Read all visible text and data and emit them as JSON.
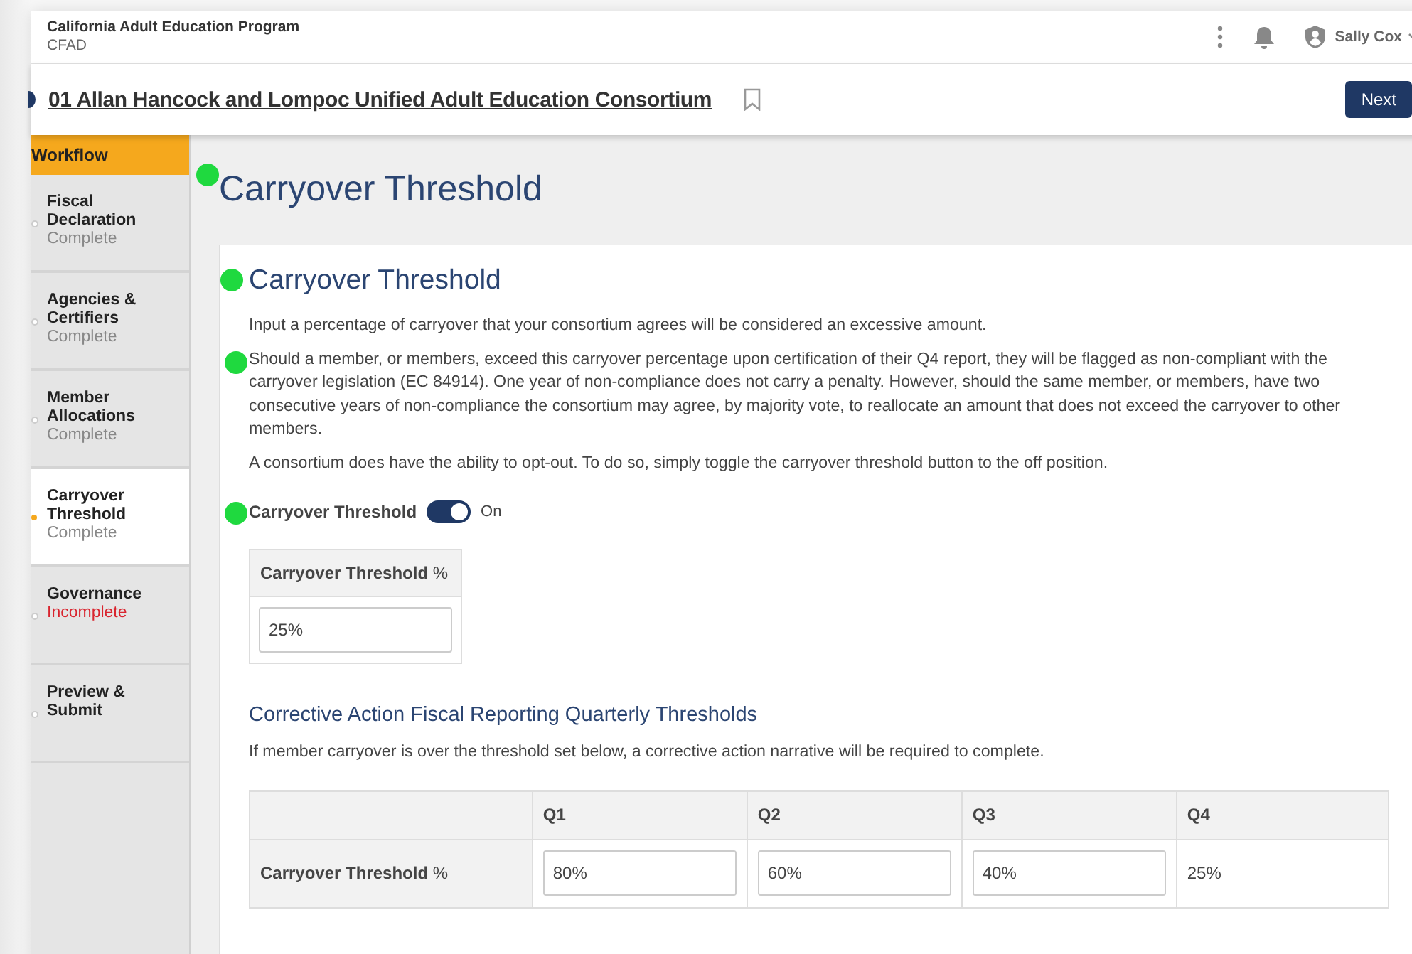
{
  "header": {
    "title": "California Adult Education Program",
    "subtitle": "CFAD",
    "user": "Sally Cox"
  },
  "consortium": {
    "name": "01 Allan Hancock and Lompoc Unified Adult Education Consortium"
  },
  "next_button": "Next",
  "sidebar": {
    "title": "Workflow",
    "items": [
      {
        "label": "Fiscal Declaration",
        "status": "Complete",
        "complete": true,
        "selected": false
      },
      {
        "label": "Agencies & Certifiers",
        "status": "Complete",
        "complete": true,
        "selected": false
      },
      {
        "label": "Member Allocations",
        "status": "Complete",
        "complete": true,
        "selected": false
      },
      {
        "label": "Carryover Threshold",
        "status": "Complete",
        "complete": true,
        "selected": true
      },
      {
        "label": "Governance",
        "status": "Incomplete",
        "complete": false,
        "selected": false
      },
      {
        "label": "Preview & Submit",
        "selected": false
      }
    ]
  },
  "page_title": "Carryover Threshold",
  "section": {
    "title": "Carryover Threshold",
    "paragraphs": [
      "Input a percentage of carryover that your consortium agrees will be considered an excessive amount.",
      "Should a member, or members, exceed this carryover percentage upon certification of their Q4 report, they will be flagged as non-compliant with the carryover legislation (EC 84914). One year of non-compliance does not carry a penalty. However, should the same member, or members, have two consecutive years of non-compliance the consortium may agree, by majority vote, to reallocate an amount that does not exceed the carryover to other members.",
      "A consortium does have the ability to opt-out. To do so, simply toggle the carryover threshold button to the off position."
    ],
    "toggle": {
      "label": "Carryover Threshold",
      "on": true,
      "state_text": "On"
    },
    "threshold_table": {
      "header": "**Carryover Threshold** %",
      "value": "25%"
    }
  },
  "quarterly": {
    "title": "Corrective Action Fiscal Reporting Quarterly Thresholds",
    "description": "If member carryover is over the threshold set below, a corrective action narrative will be required to complete.",
    "columns": [
      "Q1",
      "Q2",
      "Q3",
      "Q4"
    ],
    "row_label": "**Carryover Threshold** %",
    "cells": [
      {
        "kind": "input",
        "value": "80%"
      },
      {
        "kind": "input",
        "value": "60%"
      },
      {
        "kind": "input",
        "value": "40%"
      },
      {
        "kind": "text",
        "value": "25%"
      }
    ]
  }
}
